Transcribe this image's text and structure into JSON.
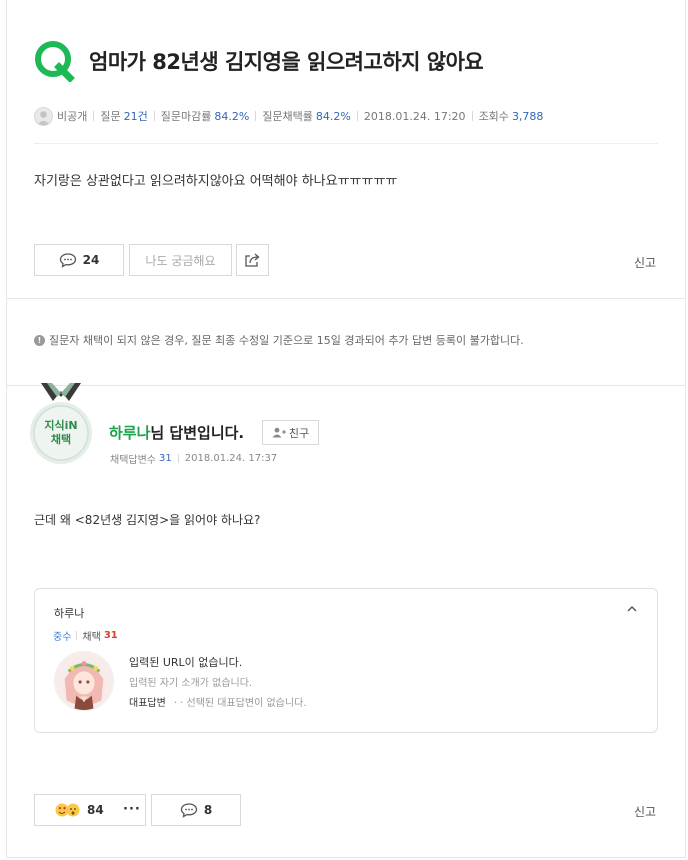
{
  "question": {
    "icon": "q-icon",
    "title": "엄마가 82년생 김지영을 읽으려고하지 않아요",
    "body": "자기랑은 상관없다고 읽으려하지않아요 어떡해야 하나요ㅠㅠㅠㅠㅠ",
    "meta": {
      "author": "비공개",
      "questions_label": "질문",
      "questions_value": "21건",
      "deadline_label": "질문마감률",
      "deadline_value": "84.2%",
      "adopt_label": "질문채택률",
      "adopt_value": "84.2%",
      "date": "2018.01.24. 17:20",
      "views_label": "조회수",
      "views_value": "3,788"
    },
    "comment_count": "24",
    "curious_label": "나도 궁금해요",
    "report_label": "신고"
  },
  "notice": "질문자 채택이 되지 않은 경우, 질문 최종 수정일 기준으로 15일 경과되어 추가 답변 등록이 불가합니다.",
  "answer": {
    "medal_line1": "지식iN",
    "medal_line2": "채택",
    "answerer_name": "하루나",
    "answerer_suffix": "님 답변입니다.",
    "friend_label": "친구",
    "adopt_label": "채택답변수",
    "adopt_value": "31",
    "date": "2018.01.24. 17:37",
    "body": "근데 왜 <82년생 김지영>을 읽어야 하나요?",
    "profile": {
      "name": "하루나",
      "grade": "중수",
      "adopt_label": "채택",
      "adopt_value": "31",
      "url_text": "입력된 URL이 없습니다.",
      "intro_text": "입력된 자기 소개가 없습니다.",
      "rep_label": "대표답변",
      "rep_text": "· · 선택된 대표답변이 없습니다."
    },
    "reaction_count": "84",
    "more_label": "···",
    "comment_count": "8",
    "report_label": "신고"
  },
  "colors": {
    "brand_green": "#1aa34a",
    "link_blue": "#3366bb",
    "accent_red": "#e03e2d"
  }
}
